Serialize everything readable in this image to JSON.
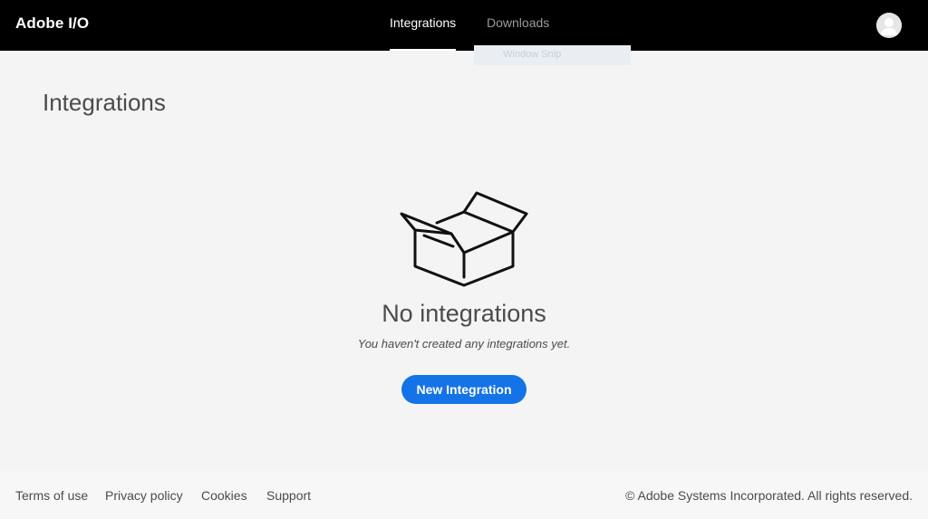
{
  "header": {
    "brand": "Adobe I/O",
    "tabs": [
      {
        "label": "Integrations",
        "active": true
      },
      {
        "label": "Downloads",
        "active": false
      }
    ],
    "avatar_icon": "user-avatar-icon"
  },
  "overlay": {
    "label": "Window Snip"
  },
  "main": {
    "title": "Integrations",
    "empty_state": {
      "icon": "open-box-icon",
      "title": "No integrations",
      "subtitle": "You haven't created any integrations yet.",
      "button_label": "New Integration"
    }
  },
  "footer": {
    "links": [
      "Terms of use",
      "Privacy policy",
      "Cookies",
      "Support"
    ],
    "copyright": "© Adobe Systems Incorporated. All rights reserved."
  },
  "colors": {
    "header_bg": "#000000",
    "page_bg": "#f4f4f4",
    "primary_button": "#1473e6"
  }
}
